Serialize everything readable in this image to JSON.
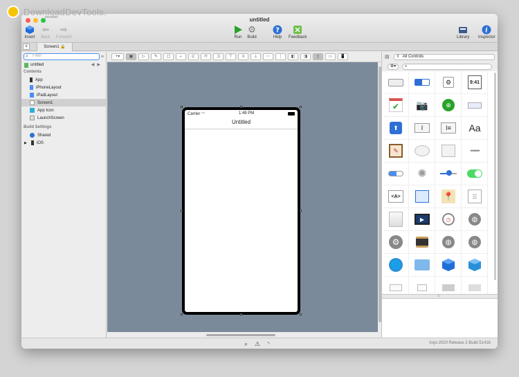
{
  "watermark": "DownloadDevTools.",
  "window": {
    "title": "untitled",
    "subtitle": "paradise"
  },
  "toolbar": {
    "insert": "Insert",
    "back": "Back",
    "forward": "Forward",
    "run": "Run",
    "build": "Build",
    "help": "Help",
    "feedback": "Feedback",
    "library": "Library",
    "inspector": "Inspector"
  },
  "tab": {
    "label": "Screen1"
  },
  "sidebar": {
    "filter_placeholder": "Filter",
    "project": "untitled",
    "contents_label": "Contents",
    "items": [
      "App",
      "iPhoneLayout",
      "iPadLayout",
      "Screen1",
      "App Icon",
      "LaunchScreen"
    ],
    "build_settings_label": "Build Settings",
    "build_items": [
      "Shared",
      "iOS"
    ]
  },
  "phone": {
    "carrier": "Carrier",
    "time": "1:49 PM",
    "title": "Untitled"
  },
  "library": {
    "filter": "All Controls",
    "tile_label": "9:41",
    "tile_label2": "Aa",
    "tile_label3": "<A>"
  },
  "footer": {
    "version": "Xojo 2020 Release 2 Build 51416"
  },
  "colors": {
    "canvas": "#7a8a9a",
    "accent": "#4a8df6"
  }
}
